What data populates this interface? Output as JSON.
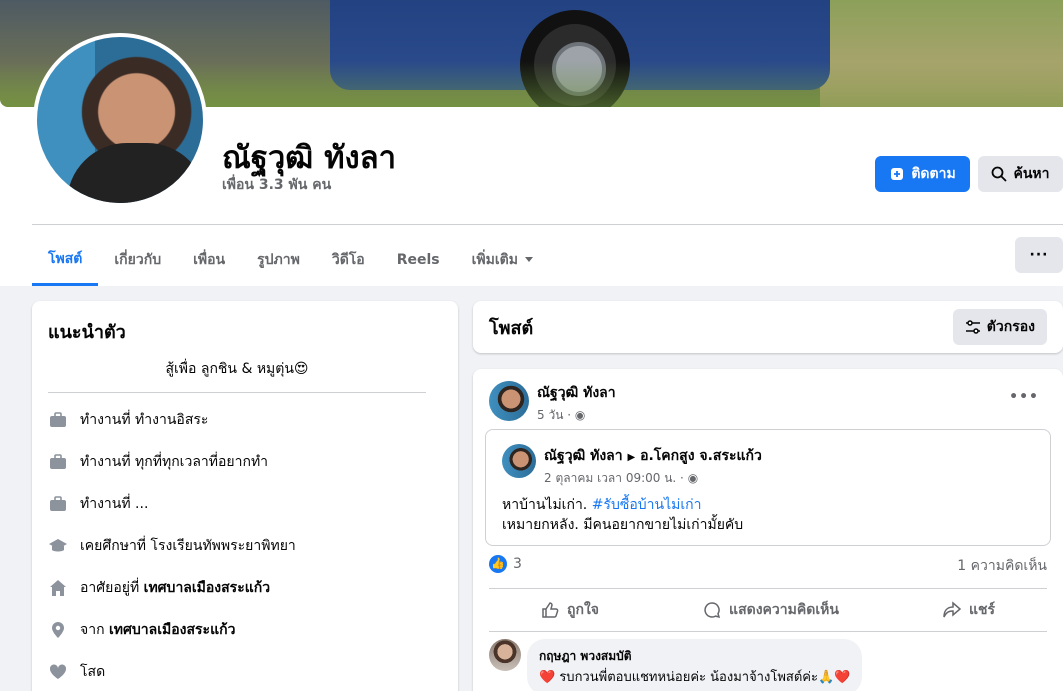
{
  "profile": {
    "name": "ณัฐวุฒิ ทังลา",
    "friends": "เพื่อน 3.3 พัน คน",
    "follow_label": "ติดตาม",
    "search_label": "ค้นหา"
  },
  "tabs": [
    {
      "label": "โพสต์"
    },
    {
      "label": "เกี่ยวกับ"
    },
    {
      "label": "เพื่อน"
    },
    {
      "label": "รูปภาพ"
    },
    {
      "label": "วิดีโอ"
    },
    {
      "label": "Reels"
    },
    {
      "label": "เพิ่มเติม"
    }
  ],
  "more_menu": "···",
  "intro": {
    "title": "แนะนำตัว",
    "bio": "สู้เพื่อ ลูกชิน & หมูตุ่น😍",
    "items": [
      {
        "icon": "briefcase-icon",
        "prefix": "ทำงานที่ ",
        "value": "ทำงานอิสระ",
        "bold": false
      },
      {
        "icon": "briefcase-icon",
        "prefix": "ทำงานที่ ",
        "value": "ทุกที่ทุกเวลาที่อยากทำ",
        "bold": false
      },
      {
        "icon": "briefcase-icon",
        "prefix": "ทำงานที่ ",
        "value": "...",
        "bold": false
      },
      {
        "icon": "graduation-cap-icon",
        "prefix": "เคยศึกษาที่ ",
        "value": "โรงเรียนทัพพระยาพิทยา",
        "bold": false
      },
      {
        "icon": "home-icon",
        "prefix": "อาศัยอยู่ที่ ",
        "value": "เทศบาลเมืองสระแก้ว",
        "bold": true
      },
      {
        "icon": "location-pin-icon",
        "prefix": "จาก ",
        "value": "เทศบาลเมืองสระแก้ว",
        "bold": true
      },
      {
        "icon": "heart-icon",
        "prefix": "โสด",
        "value": "",
        "bold": false
      }
    ]
  },
  "posts_header": {
    "title": "โพสต์",
    "filter_label": "ตัวกรอง"
  },
  "post": {
    "author": "ณัฐวุฒิ ทังลา",
    "time": "5 วัน ·",
    "shared": {
      "author": "ณัฐวุฒิ ทังลา",
      "location": "อ.โคกสูง จ.สระแก้ว",
      "time": "2 ตุลาคม เวลา 09:00 น. ·",
      "line1_text": "หาบ้านไม่เก่า. ",
      "line1_tag": "#รับซื้อบ้านไม่เก่า",
      "line2_text": "เหมายกหลัง. มีคนอยากขายไม่เก่ามั้ยคับ"
    },
    "like_count": "3",
    "comment_count": "1 ความคิดเห็น",
    "actions": {
      "like": "ถูกใจ",
      "comment": "แสดงความคิดเห็น",
      "share": "แชร์"
    },
    "comment": {
      "author": "กฤษฎา พวงสมบัติ",
      "text": "รบกวนพี่ตอบแชทหน่อยค่ะ น้องมาจ้างโพสต์ค่ะ🙏"
    }
  }
}
